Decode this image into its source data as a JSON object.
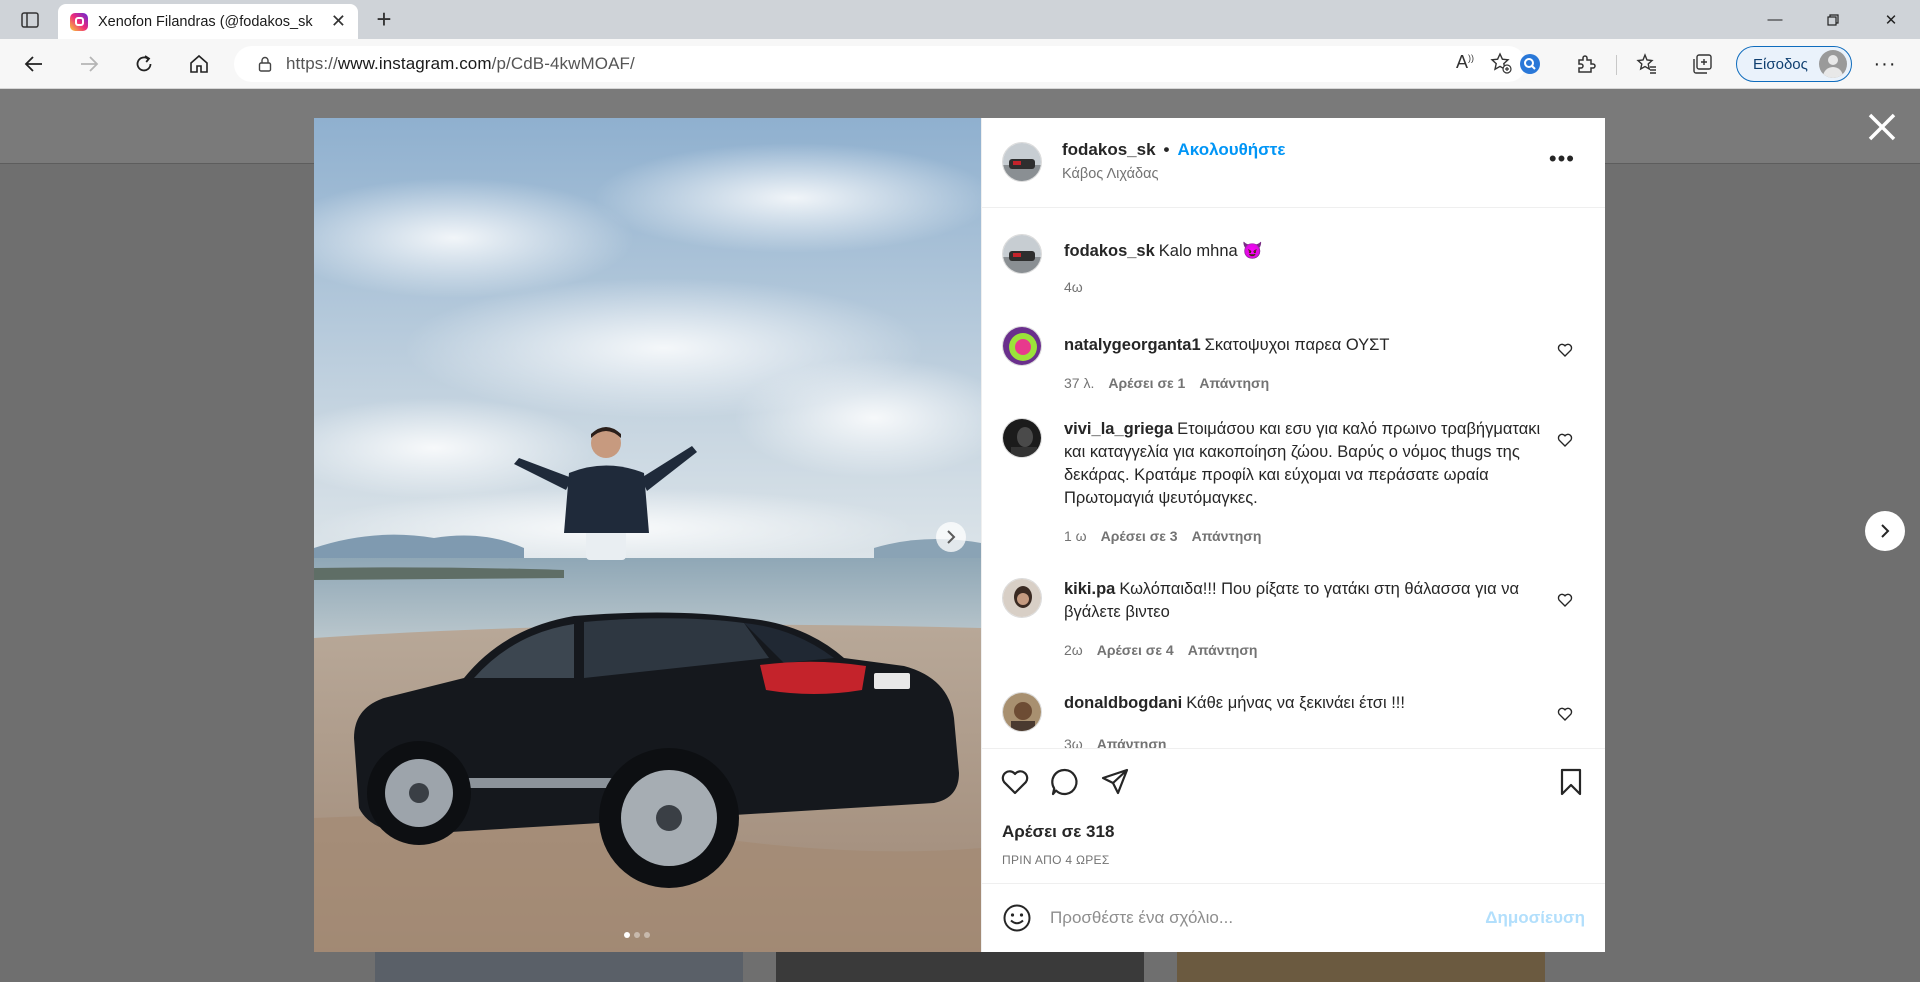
{
  "browser": {
    "tab_title": "Xenofon Filandras (@fodakos_sk",
    "url_prefix": "https://",
    "url_host": "www.instagram.com",
    "url_path": "/p/CdB-4kwMOAF/",
    "signin_label": "Είσοδος"
  },
  "post": {
    "username": "fodakos_sk",
    "follow_label": "Ακολουθήστε",
    "location": "Κάβος Λιχάδας",
    "caption_user": "fodakos_sk",
    "caption_text": "Kalo mhna 😈",
    "caption_time": "4ω",
    "likes": "Αρέσει σε 318",
    "posted": "ΠΡΙΝ ΑΠΟ 4 ΩΡΕΣ",
    "comment_placeholder": "Προσθέστε ένα σχόλιο...",
    "publish_label": "Δημοσίευση"
  },
  "comments": [
    {
      "user": "natalygeorganta1",
      "text": "Σκατοψυχοι παρεα ΟΥΣΤ",
      "time": "37 λ.",
      "likes": "Αρέσει σε 1",
      "reply": "Απάντηση"
    },
    {
      "user": "vivi_la_griega",
      "text": "Ετοιμάσου και εσυ για καλό πρωινο τραβήγματακι και καταγγελία για κακοποίηση ζώου. Βαρύς ο νόμος thugs της δεκάρας. Κρατάμε προφίλ και εύχομαι να περάσατε ωραία Πρωτομαγιά ψευτόμαγκες.",
      "time": "1 ω",
      "likes": "Αρέσει σε 3",
      "reply": "Απάντηση"
    },
    {
      "user": "kiki.pa",
      "text": "Κωλόπαιδα!!! Που ρίξατε το γατάκι στη θάλασσα για να βγάλετε βιντεο",
      "time": "2ω",
      "likes": "Αρέσει σε 4",
      "reply": "Απάντηση"
    },
    {
      "user": "donaldbogdani",
      "text": "Κάθε μήνας να ξεκινάει έτσι !!!",
      "time": "3ω",
      "likes": "",
      "reply": "Απάντηση"
    }
  ],
  "colors": {
    "accent": "#0095f6",
    "publish_disabled": "#b2dffc"
  }
}
